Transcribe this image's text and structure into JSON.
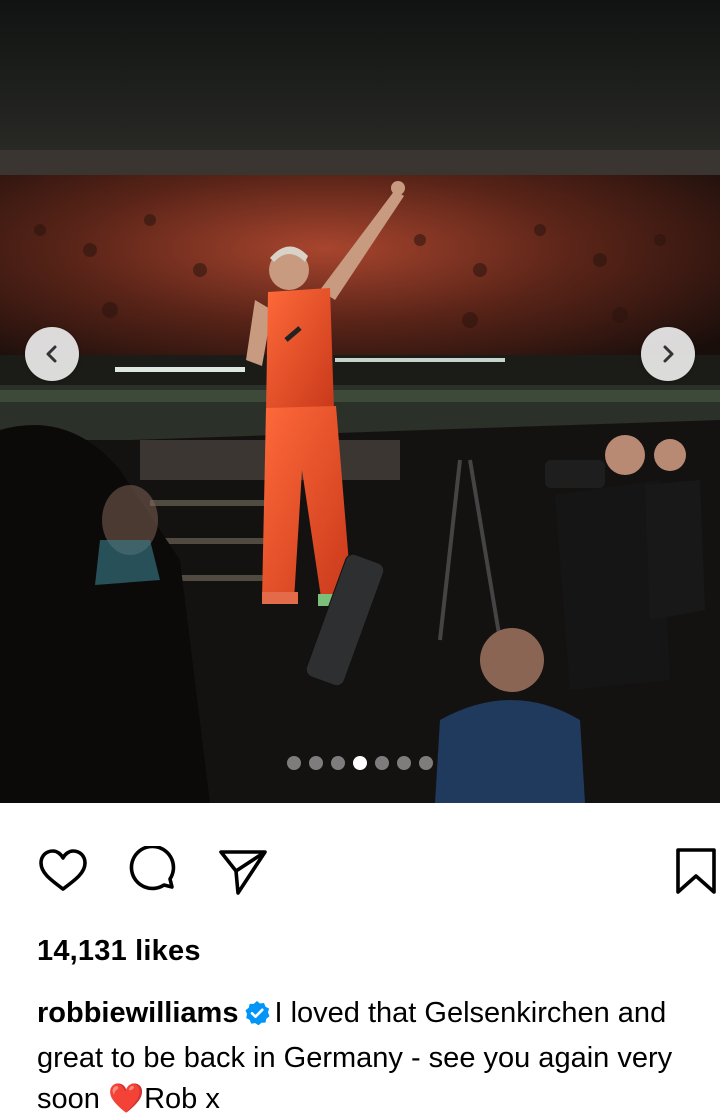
{
  "post": {
    "media": {
      "description_icon": "concert-photo",
      "carousel": {
        "total": 7,
        "active_index": 3
      },
      "prev_icon": "chevron-left-icon",
      "next_icon": "chevron-right-icon"
    },
    "actions": {
      "like_icon": "heart-icon",
      "comment_icon": "comment-icon",
      "share_icon": "send-icon",
      "save_icon": "bookmark-icon"
    },
    "likes_text": "14,131 likes",
    "caption": {
      "username": "robbiewilliams",
      "verified_icon": "verified-badge-icon",
      "text_before_emoji": "I loved that Gelsenkirchen and great to be back in Germany - see you again very soon ",
      "emoji": "❤️",
      "text_after_emoji": "Rob x"
    }
  },
  "colors": {
    "verified_blue": "#0095f6",
    "heart_red": "#e0161e",
    "stage_orange": "#e8502a"
  }
}
